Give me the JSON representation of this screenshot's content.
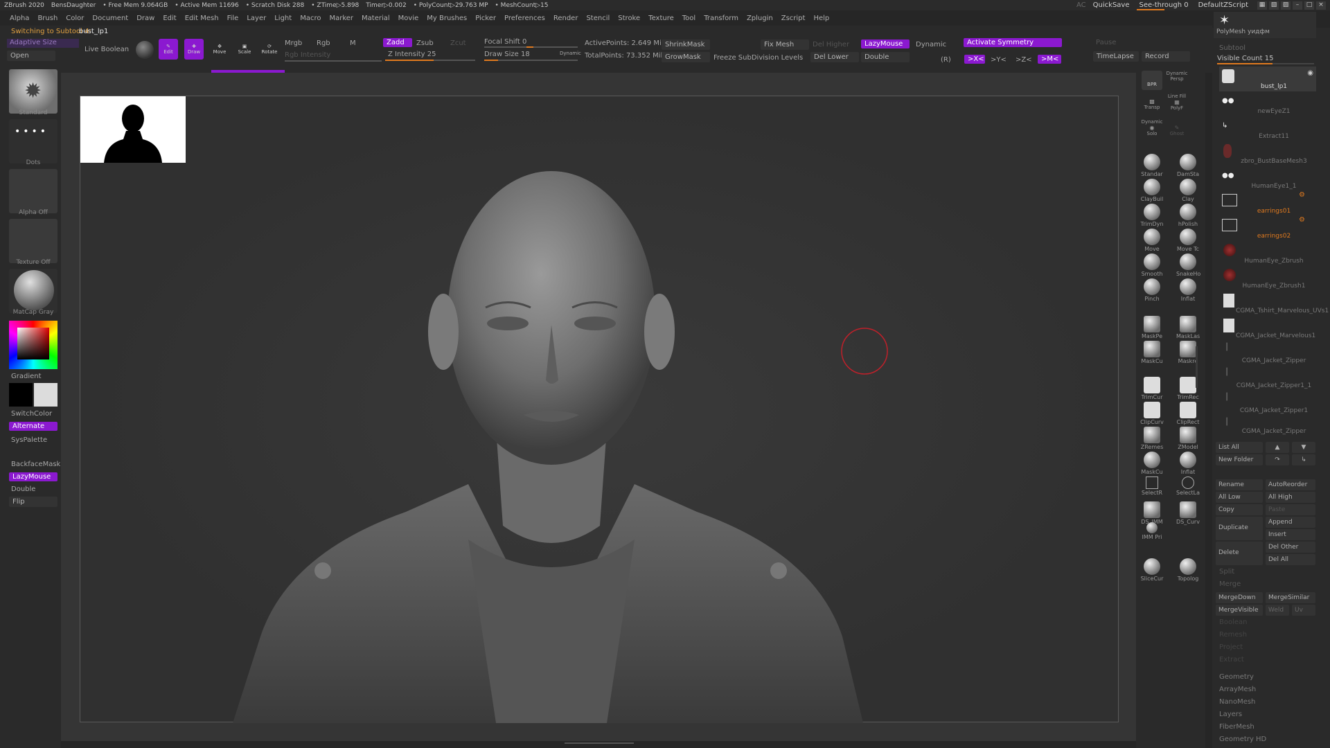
{
  "titlebar": {
    "app": "ZBrush 2020",
    "doc": "BensDaughter",
    "free_mem": "• Free Mem 9.064GB",
    "active_mem": "• Active Mem 11696",
    "scratch": "• Scratch Disk 288",
    "ztime": "• ZTime▷5.898",
    "timer": "Timer▷0.002",
    "polycount": "• PolyCount▷29.763 MP",
    "meshcount": "• MeshCount▷15",
    "ac": "AC",
    "quicksave": "QuickSave",
    "seethrough": "See-through  0",
    "default_zscript": "DefaultZScript"
  },
  "menu": [
    "Alpha",
    "Brush",
    "Color",
    "Document",
    "Draw",
    "Edit",
    "Edit Mesh",
    "File",
    "Layer",
    "Light",
    "Macro",
    "Marker",
    "Material",
    "Movie",
    "My Brushes",
    "Picker",
    "Preferences",
    "Render",
    "Stencil",
    "Stroke",
    "Texture",
    "Tool",
    "Transform",
    "Zplugin",
    "Zscript",
    "Help"
  ],
  "status": {
    "msg": "Switching to Subtool 4:",
    "name": "bust_lp1"
  },
  "toolbar": {
    "adaptive_size": "Adaptive Size",
    "open": "Open",
    "live_boolean": "Live Boolean",
    "edit": "Edit",
    "draw": "Draw",
    "move": "Move",
    "scale": "Scale",
    "rotate": "Rotate",
    "mrgb": "Mrgb",
    "rgb": "Rgb",
    "m": "M",
    "rgb_intensity": "Rgb Intensity",
    "zadd": "Zadd",
    "zsub": "Zsub",
    "zcut": "Zcut",
    "z_intensity": "Z Intensity 25",
    "focal_shift": "Focal Shift 0",
    "draw_size": "Draw Size 18",
    "dynamic": "Dynamic",
    "active_points": "ActivePoints: 2.649 Mil",
    "total_points": "TotalPoints: 73.352 Mil",
    "shrinkmask": "ShrinkMask",
    "growmask": "GrowMask",
    "fix_mesh": "Fix Mesh",
    "freeze_subdiv": "Freeze SubDivision Levels",
    "del_higher": "Del Higher",
    "del_lower": "Del Lower",
    "lazymouse": "LazyMouse",
    "double": "Double",
    "dynamic2": "Dynamic",
    "activate_symmetry": "Activate Symmetry",
    "r": "(R)",
    "x": ">X<",
    "y": ">Y<",
    "z": ">Z<",
    "m_sym": ">M<",
    "pause": "Pause",
    "timelapse": "TimeLapse",
    "record": "Record"
  },
  "left": {
    "standard": "Standard",
    "dots": "Dots",
    "alpha_off": "Alpha Off",
    "texture_off": "Texture Off",
    "matcap": "MatCap Gray",
    "gradient": "Gradient",
    "switchcolor": "SwitchColor",
    "alternate": "Alternate",
    "syspalette": "SysPalette",
    "backfacemask": "BackfaceMask",
    "lazymouse": "LazyMouse",
    "double": "Double",
    "flip": "Flip"
  },
  "right_top": {
    "bpr": "BPR",
    "dynamic": "Dynamic",
    "persp": "Persp",
    "transp": "Transp",
    "linefill": "Line Fill",
    "polyf": "PolyF",
    "dynamic2": "Dynamic",
    "solo": "Solo",
    "ghost": "Ghost"
  },
  "brushes": [
    [
      "Standar",
      "DamSta"
    ],
    [
      "ClayBuil",
      "Clay"
    ],
    [
      "TrimDyn",
      "hPolish"
    ],
    [
      "Move",
      "Move Tc"
    ],
    [
      "Smooth",
      "SnakeHo"
    ],
    [
      "Pinch",
      "Inflat"
    ],
    [
      "MaskPe",
      "MaskLas"
    ],
    [
      "MaskCu",
      "Maskre"
    ],
    [
      "TrimCur",
      "TrimRec"
    ],
    [
      "ClipCurv",
      "ClipRect"
    ],
    [
      "ZRemes",
      "ZModel"
    ],
    [
      "MaskCu",
      "Inflat"
    ],
    [
      "SelectR",
      "SelectLa"
    ],
    [
      "DS_IMM",
      "DS_Curv"
    ],
    [
      "IMM Pri",
      ""
    ],
    [
      "SliceCur",
      "Topolog"
    ]
  ],
  "subtool": {
    "polymesh_label": "PolyMesh уидфм",
    "header": "Subtool",
    "visible_count": "Visible Count 15",
    "items": [
      "bust_lp1",
      "newEyeZ1",
      "Extract11",
      "zbro_BustBaseMesh3",
      "HumanEye1_1",
      "earrings01",
      "earrings02",
      "HumanEye_Zbrush",
      "HumanEye_Zbrush1",
      "CGMA_Tshirt_Marvelous_UVs1",
      "CGMA_Jacket_Marvelous1",
      "CGMA_Jacket_Zipper",
      "CGMA_Jacket_Zipper1_1",
      "CGMA_Jacket_Zipper1",
      "CGMA_Jacket_Zipper"
    ],
    "list_all": "List All",
    "new_folder": "New Folder",
    "rename": "Rename",
    "autoreorder": "AutoReorder",
    "all_low": "All Low",
    "all_high": "All High",
    "copy": "Copy",
    "paste": "Paste",
    "append": "Append",
    "duplicate": "Duplicate",
    "insert": "Insert",
    "delete": "Delete",
    "del_other": "Del Other",
    "del_all": "Del All",
    "split": "Split",
    "merge": "Merge",
    "mergedown": "MergeDown",
    "mergesimilar": "MergeSimilar",
    "mergevisible": "MergeVisible",
    "weld": "Weld",
    "uv": "Uv",
    "boolean": "Boolean",
    "remesh": "Remesh",
    "project": "Project",
    "extract": "Extract",
    "geometry": "Geometry",
    "arraymesh": "ArrayMesh",
    "nanomesh": "NanoMesh",
    "layers": "Layers",
    "fibermesh": "FiberMesh",
    "geometry_hd": "Geometry HD"
  },
  "colors": {
    "accent": "#8b19d0",
    "orange": "#e07a1f",
    "bg": "#262626",
    "viewport": "#353535"
  }
}
